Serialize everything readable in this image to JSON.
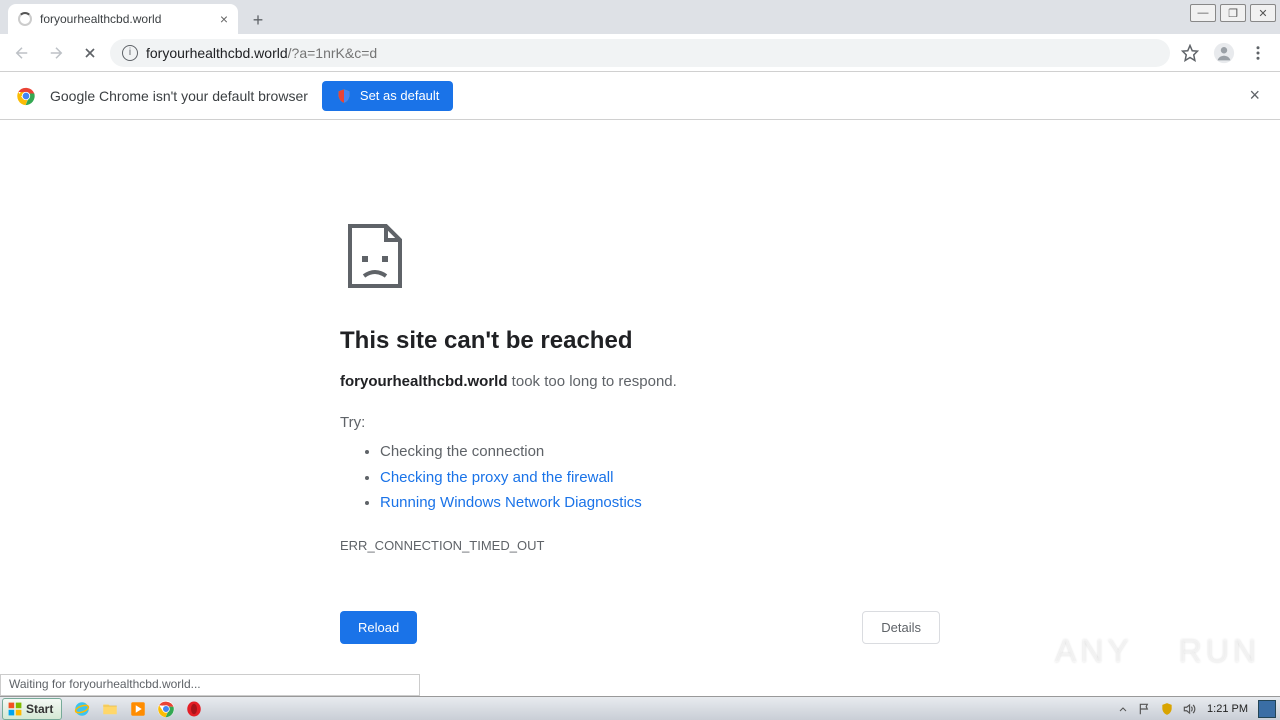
{
  "tab": {
    "title": "foryourhealthcbd.world"
  },
  "address": {
    "host": "foryourhealthcbd.world",
    "path": "/?a=1nrK&c=d"
  },
  "infobar": {
    "message": "Google Chrome isn't your default browser",
    "button": "Set as default"
  },
  "error": {
    "title": "This site can't be reached",
    "host": "foryourhealthcbd.world",
    "msg_suffix": " took too long to respond.",
    "try_label": "Try:",
    "suggestions": {
      "plain": "Checking the connection",
      "link1": "Checking the proxy and the firewall",
      "link2": "Running Windows Network Diagnostics"
    },
    "code": "ERR_CONNECTION_TIMED_OUT",
    "reload": "Reload",
    "details": "Details"
  },
  "status": "Waiting for foryourhealthcbd.world...",
  "taskbar": {
    "start": "Start",
    "clock": "1:21 PM"
  },
  "watermark": {
    "left": "ANY",
    "right": "RUN"
  }
}
